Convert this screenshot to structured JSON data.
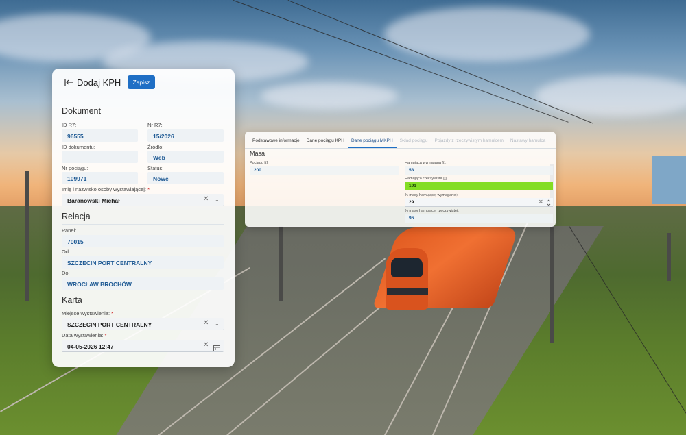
{
  "window": {
    "title": "Dodaj KPH",
    "save_label": "Zapisz"
  },
  "left_panel": {
    "dokument": {
      "title": "Dokument",
      "id_r7_label": "ID R7:",
      "id_r7_value": "96555",
      "nr_r7_label": "Nr R7:",
      "nr_r7_value": "15/2026",
      "id_dok_label": "ID dokumentu:",
      "id_dok_value": "",
      "zrodlo_label": "Źródło:",
      "zrodlo_value": "Web",
      "nr_pociagu_label": "Nr pociągu:",
      "nr_pociagu_value": "109971",
      "status_label": "Status:",
      "status_value": "Nowe",
      "osoba_label": "Imię i nazwisko osoby wystawiającej:",
      "osoba_value": "Baranowski Michał"
    },
    "relacja": {
      "title": "Relacja",
      "panel_label": "Panel:",
      "panel_value": "70015",
      "od_label": "Od:",
      "od_value": "SZCZECIN PORT CENTRALNY",
      "do_label": "Do:",
      "do_value": "WROCŁAW BROCHÓW"
    },
    "karta": {
      "title": "Karta",
      "miejsce_label": "Miejsce wystawienia:",
      "miejsce_value": "SZCZECIN PORT CENTRALNY",
      "data_label": "Data wystawienia:",
      "data_value": "04-05-2026 12:47"
    },
    "required_mark": "*"
  },
  "right_panel": {
    "tabs": [
      {
        "label": "Podstawowe informacje",
        "state": "normal"
      },
      {
        "label": "Dane pociągu KPH",
        "state": "normal"
      },
      {
        "label": "Dane pociągu MKPH",
        "state": "active"
      },
      {
        "label": "Skład pociągu",
        "state": "disabled"
      },
      {
        "label": "Pojazdy z rzeczywistym hamulcem",
        "state": "disabled"
      },
      {
        "label": "Nastawy hamulca",
        "state": "disabled"
      }
    ],
    "masa": {
      "title": "Masa",
      "pociagu_label": "Pociągu [t]:",
      "pociagu_value": "200",
      "ham_wymagana_label": "Hamująca wymagana [t]:",
      "ham_wymagana_value": "58",
      "ham_rzeczywista_label": "Hamująca rzeczywista [t]:",
      "ham_rzeczywista_value": "191",
      "pct_wymaganej_label": "% masy hamującej wymaganej:",
      "pct_wymaganej_value": "29",
      "pct_rzeczywistej_label": "% masy hamującej rzeczywistej:",
      "pct_rzeczywistej_value": "96"
    }
  },
  "colors": {
    "accent": "#1f6fc5",
    "value_text": "#1f5a94",
    "highlight_green": "#84dd24",
    "required": "#d02020"
  },
  "icons": [
    "back-arrow-icon",
    "clear-icon",
    "chevron-down-icon",
    "calendar-icon",
    "spinner-arrows-icon"
  ]
}
